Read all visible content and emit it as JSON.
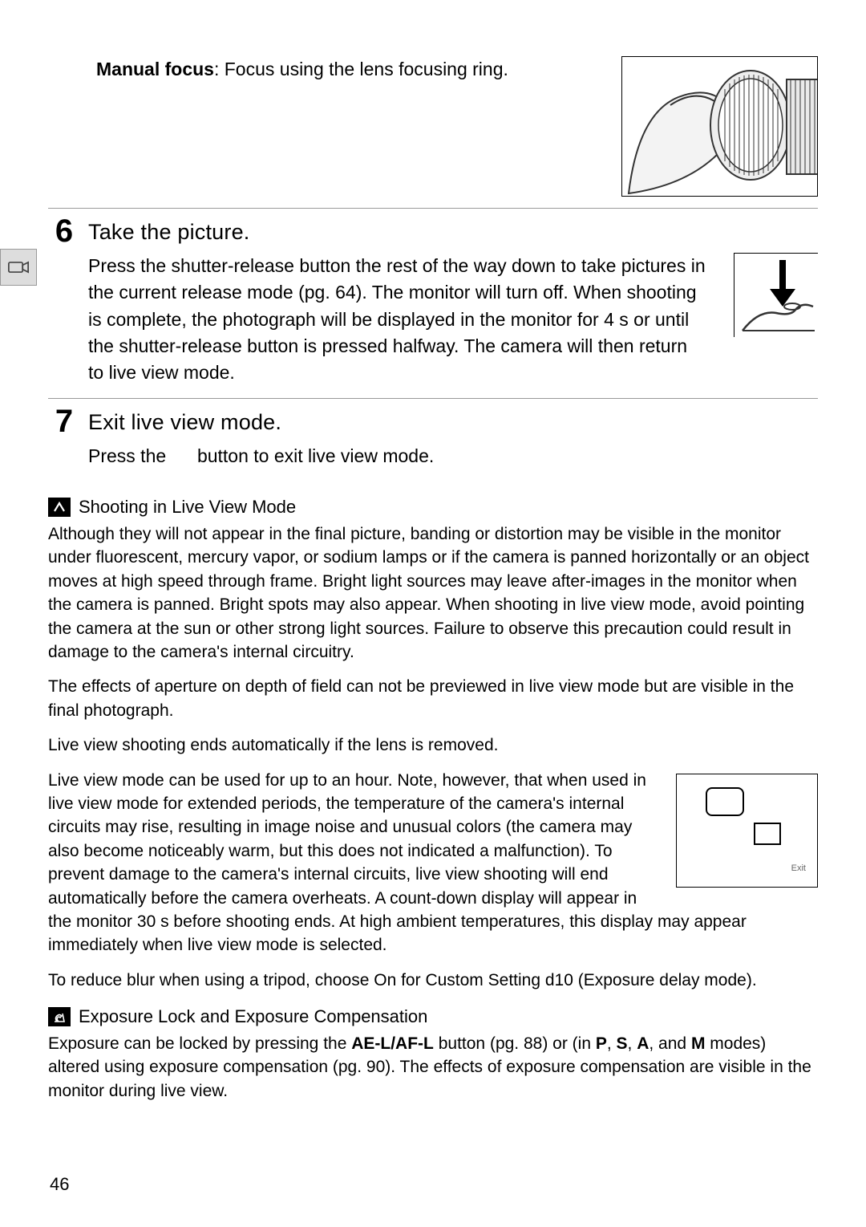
{
  "manual": {
    "label": "Manual focus",
    "tail": ": Focus using the lens focusing ring."
  },
  "step6": {
    "num": "6",
    "title": "Take the picture.",
    "text": "Press the shutter-release button the rest of the way down to take pictures in the current release mode (pg. 64).  The monitor will turn off.  When shooting is complete, the photograph will be displayed in the monitor for 4 s or until the shutter-release button is pressed halfway.  The camera will then return to live view mode."
  },
  "step7": {
    "num": "7",
    "title": "Exit live view mode.",
    "text_a": "Press the ",
    "text_b": " button to exit live view mode."
  },
  "note1": {
    "badge": "D",
    "title": "Shooting in Live View Mode",
    "p1": "Although they will not appear in the final picture, banding or distortion may be visible in the monitor under fluorescent, mercury vapor, or sodium lamps or if the camera is panned horizontally or an object moves at high speed through frame.  Bright light sources may leave after-images in the monitor when the camera is panned.  Bright spots may also appear.  When shooting in live view mode, avoid pointing the camera at the sun or other strong light sources.  Failure to observe this precaution could result in damage to the camera's internal circuitry.",
    "p2": "The effects of aperture on depth of field can not be previewed in live view mode but are visible in the final photograph.",
    "p3": "Live view shooting ends automatically if the lens is removed.",
    "p4": "Live view mode can be used for up to an hour.  Note, however, that when used in live view mode for extended periods, the temperature of the camera's internal circuits may rise, resulting in image noise and unusual colors (the camera may also become noticeably warm, but this does not indicated a malfunction).  To prevent damage to the camera's internal circuits, live view shooting will end automatically before the camera overheats.  A count-down display will appear in the monitor 30 s before shooting ends.  At high ambient temperatures, this display may appear immediately when live view mode is selected.",
    "p5a": "To reduce blur when using a tripod, choose ",
    "p5b": "On",
    "p5c": " for Custom Setting d10 (",
    "p5d": "Exposure delay mode",
    "p5e": ")."
  },
  "note2": {
    "badge": "A",
    "title": "Exposure Lock and Exposure Compensation",
    "t1": "Exposure can be locked by pressing the ",
    "t2": "AE-L/AF-L",
    "t3": " button (pg. 88) or (in ",
    "t4": "P",
    "t5": ", ",
    "t6": "S",
    "t7": ", ",
    "t8": "A",
    "t9": ", and ",
    "t10": "M",
    "t11": " modes) altered using exposure compensation (pg. 90).  The effects of exposure compensation are visible in the monitor during live view."
  },
  "exit_label": "Exit",
  "page_number": "46"
}
